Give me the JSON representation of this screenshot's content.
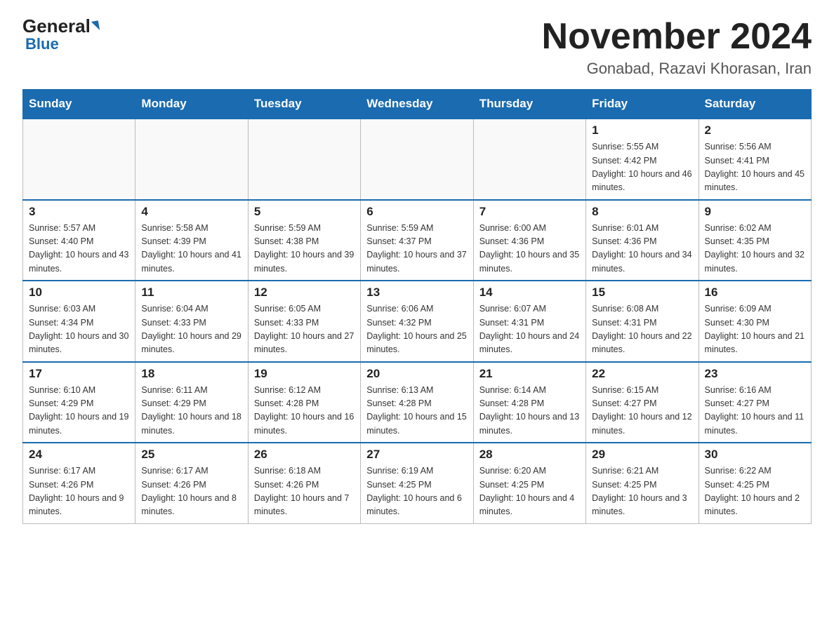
{
  "header": {
    "logo_general": "General",
    "logo_blue": "Blue",
    "month_title": "November 2024",
    "location": "Gonabad, Razavi Khorasan, Iran"
  },
  "weekdays": [
    "Sunday",
    "Monday",
    "Tuesday",
    "Wednesday",
    "Thursday",
    "Friday",
    "Saturday"
  ],
  "weeks": [
    [
      {
        "day": "",
        "info": ""
      },
      {
        "day": "",
        "info": ""
      },
      {
        "day": "",
        "info": ""
      },
      {
        "day": "",
        "info": ""
      },
      {
        "day": "",
        "info": ""
      },
      {
        "day": "1",
        "info": "Sunrise: 5:55 AM\nSunset: 4:42 PM\nDaylight: 10 hours and 46 minutes."
      },
      {
        "day": "2",
        "info": "Sunrise: 5:56 AM\nSunset: 4:41 PM\nDaylight: 10 hours and 45 minutes."
      }
    ],
    [
      {
        "day": "3",
        "info": "Sunrise: 5:57 AM\nSunset: 4:40 PM\nDaylight: 10 hours and 43 minutes."
      },
      {
        "day": "4",
        "info": "Sunrise: 5:58 AM\nSunset: 4:39 PM\nDaylight: 10 hours and 41 minutes."
      },
      {
        "day": "5",
        "info": "Sunrise: 5:59 AM\nSunset: 4:38 PM\nDaylight: 10 hours and 39 minutes."
      },
      {
        "day": "6",
        "info": "Sunrise: 5:59 AM\nSunset: 4:37 PM\nDaylight: 10 hours and 37 minutes."
      },
      {
        "day": "7",
        "info": "Sunrise: 6:00 AM\nSunset: 4:36 PM\nDaylight: 10 hours and 35 minutes."
      },
      {
        "day": "8",
        "info": "Sunrise: 6:01 AM\nSunset: 4:36 PM\nDaylight: 10 hours and 34 minutes."
      },
      {
        "day": "9",
        "info": "Sunrise: 6:02 AM\nSunset: 4:35 PM\nDaylight: 10 hours and 32 minutes."
      }
    ],
    [
      {
        "day": "10",
        "info": "Sunrise: 6:03 AM\nSunset: 4:34 PM\nDaylight: 10 hours and 30 minutes."
      },
      {
        "day": "11",
        "info": "Sunrise: 6:04 AM\nSunset: 4:33 PM\nDaylight: 10 hours and 29 minutes."
      },
      {
        "day": "12",
        "info": "Sunrise: 6:05 AM\nSunset: 4:33 PM\nDaylight: 10 hours and 27 minutes."
      },
      {
        "day": "13",
        "info": "Sunrise: 6:06 AM\nSunset: 4:32 PM\nDaylight: 10 hours and 25 minutes."
      },
      {
        "day": "14",
        "info": "Sunrise: 6:07 AM\nSunset: 4:31 PM\nDaylight: 10 hours and 24 minutes."
      },
      {
        "day": "15",
        "info": "Sunrise: 6:08 AM\nSunset: 4:31 PM\nDaylight: 10 hours and 22 minutes."
      },
      {
        "day": "16",
        "info": "Sunrise: 6:09 AM\nSunset: 4:30 PM\nDaylight: 10 hours and 21 minutes."
      }
    ],
    [
      {
        "day": "17",
        "info": "Sunrise: 6:10 AM\nSunset: 4:29 PM\nDaylight: 10 hours and 19 minutes."
      },
      {
        "day": "18",
        "info": "Sunrise: 6:11 AM\nSunset: 4:29 PM\nDaylight: 10 hours and 18 minutes."
      },
      {
        "day": "19",
        "info": "Sunrise: 6:12 AM\nSunset: 4:28 PM\nDaylight: 10 hours and 16 minutes."
      },
      {
        "day": "20",
        "info": "Sunrise: 6:13 AM\nSunset: 4:28 PM\nDaylight: 10 hours and 15 minutes."
      },
      {
        "day": "21",
        "info": "Sunrise: 6:14 AM\nSunset: 4:28 PM\nDaylight: 10 hours and 13 minutes."
      },
      {
        "day": "22",
        "info": "Sunrise: 6:15 AM\nSunset: 4:27 PM\nDaylight: 10 hours and 12 minutes."
      },
      {
        "day": "23",
        "info": "Sunrise: 6:16 AM\nSunset: 4:27 PM\nDaylight: 10 hours and 11 minutes."
      }
    ],
    [
      {
        "day": "24",
        "info": "Sunrise: 6:17 AM\nSunset: 4:26 PM\nDaylight: 10 hours and 9 minutes."
      },
      {
        "day": "25",
        "info": "Sunrise: 6:17 AM\nSunset: 4:26 PM\nDaylight: 10 hours and 8 minutes."
      },
      {
        "day": "26",
        "info": "Sunrise: 6:18 AM\nSunset: 4:26 PM\nDaylight: 10 hours and 7 minutes."
      },
      {
        "day": "27",
        "info": "Sunrise: 6:19 AM\nSunset: 4:25 PM\nDaylight: 10 hours and 6 minutes."
      },
      {
        "day": "28",
        "info": "Sunrise: 6:20 AM\nSunset: 4:25 PM\nDaylight: 10 hours and 4 minutes."
      },
      {
        "day": "29",
        "info": "Sunrise: 6:21 AM\nSunset: 4:25 PM\nDaylight: 10 hours and 3 minutes."
      },
      {
        "day": "30",
        "info": "Sunrise: 6:22 AM\nSunset: 4:25 PM\nDaylight: 10 hours and 2 minutes."
      }
    ]
  ]
}
